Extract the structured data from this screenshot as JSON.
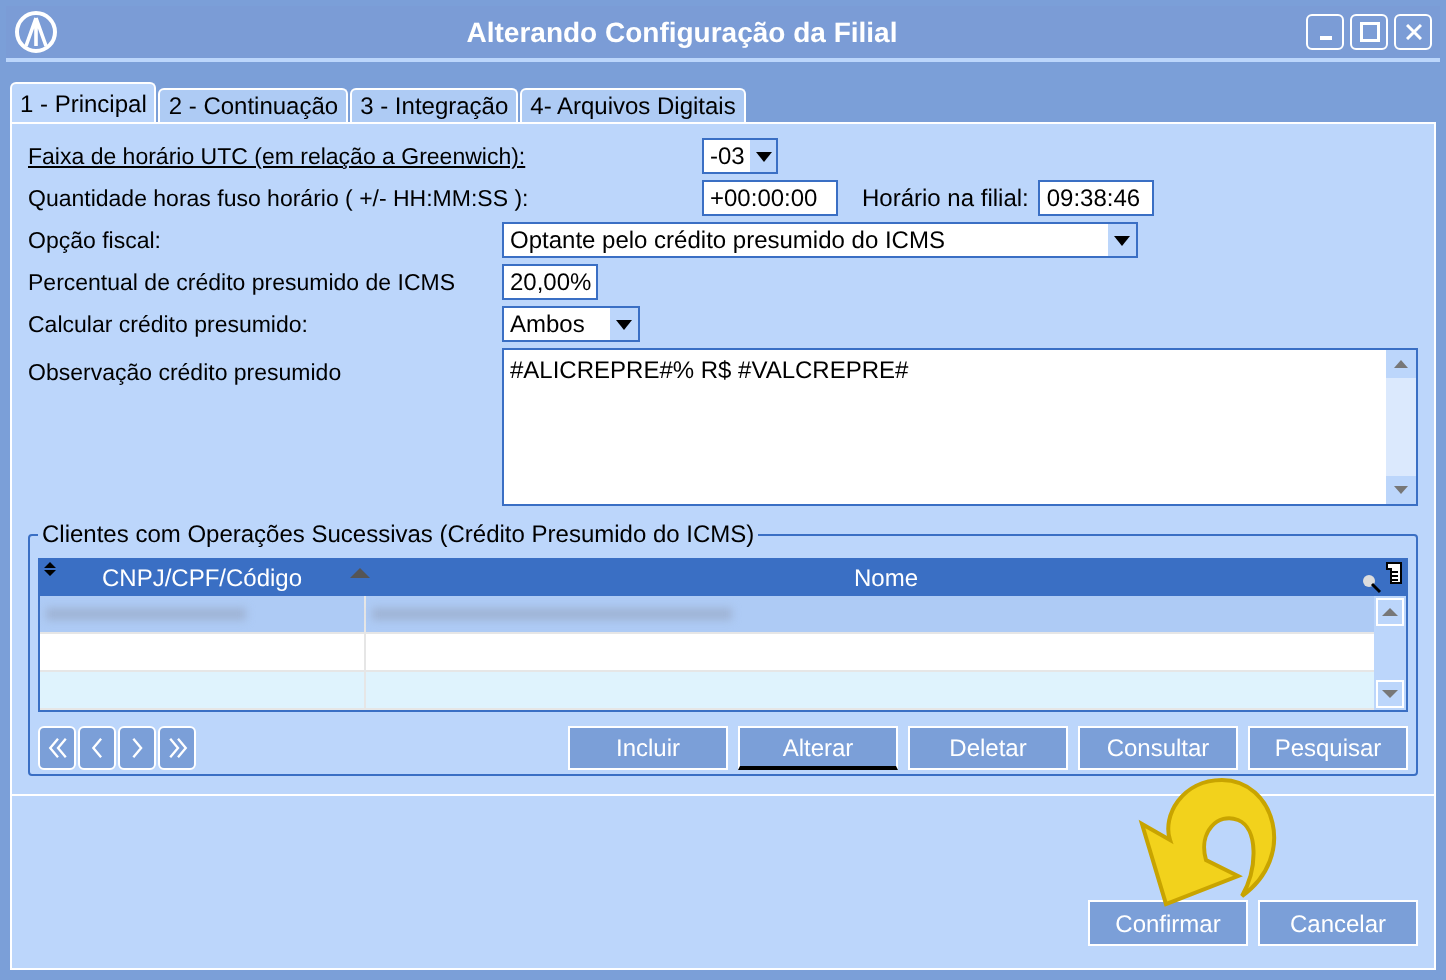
{
  "window": {
    "title": "Alterando Configuração da Filial"
  },
  "tabs": [
    {
      "label": "1 - Principal",
      "selected": true
    },
    {
      "label": "2 - Continuação",
      "selected": false
    },
    {
      "label": "3 - Integração",
      "selected": false
    },
    {
      "label": "4- Arquivos Digitais",
      "selected": false
    }
  ],
  "form": {
    "utc_label": "Faixa de horário UTC (em relação a Greenwich):",
    "utc_value": "-03",
    "offset_label": "Quantidade horas fuso horário ( +/- HH:MM:SS ):",
    "offset_value": "+00:00:00",
    "branch_time_label": "Horário na filial:",
    "branch_time_value": "09:38:46",
    "fiscal_label": "Opção fiscal:",
    "fiscal_value": "Optante pelo crédito presumido do ICMS",
    "percent_label": "Percentual de crédito presumido de ICMS",
    "percent_value": "20,00%",
    "calc_label": "Calcular crédito presumido:",
    "calc_value": "Ambos",
    "obs_label": "Observação crédito presumido",
    "obs_value": "#ALICREPRE#% R$ #VALCREPRE#"
  },
  "clients": {
    "title": "Clientes com Operações Sucessivas (Crédito Presumido do ICMS)",
    "columns": [
      "CNPJ/CPF/Código",
      "Nome"
    ],
    "rows": [
      {
        "selected": true,
        "blurred": true
      },
      {
        "selected": false,
        "blurred": false
      },
      {
        "selected": false,
        "blurred": false
      }
    ],
    "buttons": [
      "Incluir",
      "Alterar",
      "Deletar",
      "Consultar",
      "Pesquisar"
    ]
  },
  "footer_buttons": [
    "Confirmar",
    "Cancelar"
  ]
}
